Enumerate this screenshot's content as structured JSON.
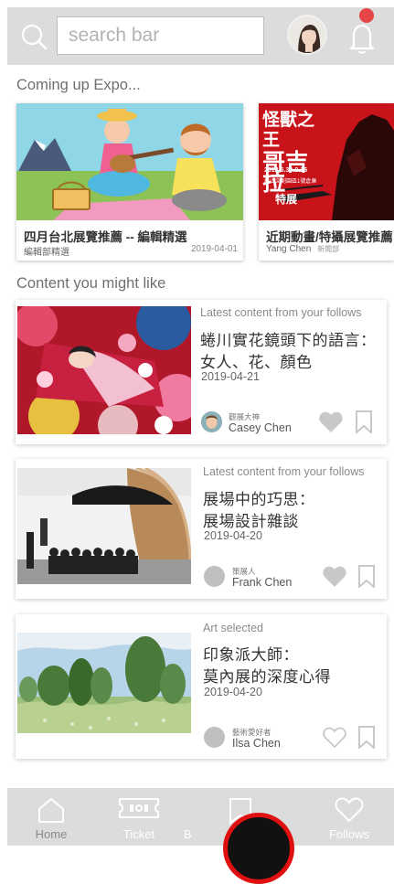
{
  "header": {
    "search_placeholder": "search bar",
    "notification_dot_color": "#e64646"
  },
  "sections": {
    "coming_up": "Coming up Expo...",
    "content_like": "Content you might like"
  },
  "expos": [
    {
      "title": "四月台北展覽推薦 -- 編輯精選",
      "sub": "編輯部精選",
      "date": "2019-04-01"
    },
    {
      "title": "近期動畫/特攝展覽推薦",
      "sub": "Yang Chen",
      "sub2": "新聞部",
      "date": ""
    }
  ],
  "expo_poster_text": [
    "怪獸之王",
    "哥吉拉",
    "特展",
    "2018.6.30-9.16",
    "松山文創園區1號倉庫"
  ],
  "contents": [
    {
      "category": "Latest content from your follows",
      "title1": "蜷川實花鏡頭下的語言：",
      "title2": "女人、花、顏色",
      "date": "2019-04-21",
      "role": "觀展大神",
      "author": "Casey Chen",
      "liked": true
    },
    {
      "category": "Latest content from your follows",
      "title1": "展場中的巧思：",
      "title2": "展場設計雜談",
      "date": "2019-04-20",
      "role": "策展人",
      "author": "Frank Chen",
      "liked": true
    },
    {
      "category": "Art selected",
      "title1": "印象派大師：",
      "title2": "莫內展的深度心得",
      "date": "2019-04-20",
      "role": "藝術愛好者",
      "author": "Ilsa Chen",
      "liked": false
    }
  ],
  "tabs": [
    {
      "label": "Home"
    },
    {
      "label": "Ticket"
    },
    {
      "label": "B"
    },
    {
      "label": "Follows"
    }
  ],
  "colors": {
    "header_bg": "#dcdcdc",
    "fab_ring": "#e01010"
  }
}
